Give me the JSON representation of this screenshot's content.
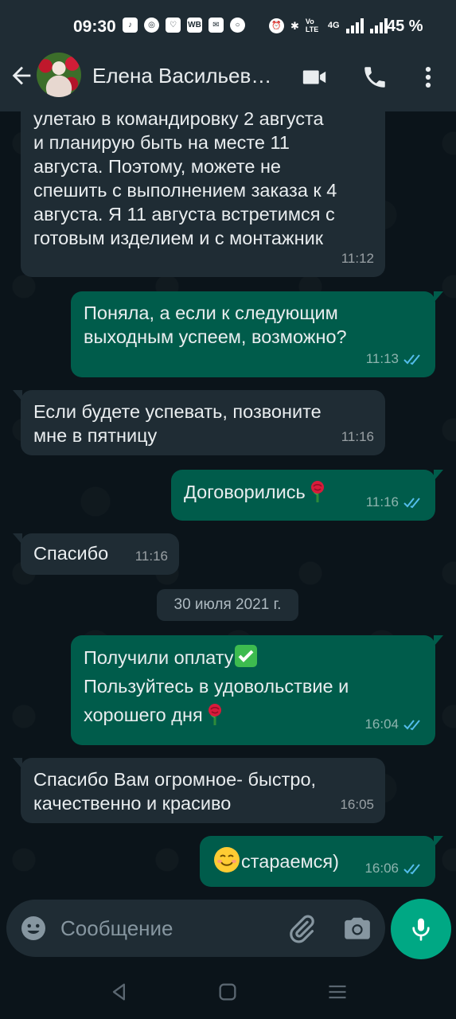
{
  "status_bar": {
    "time": "09:30",
    "battery": "45 %",
    "network_4g": "4G",
    "volte": "Vo LTE"
  },
  "header": {
    "contact_name": "Елена Васильев…"
  },
  "messages": [
    {
      "direction": "incoming",
      "text": "улетаю в командировку 2 августа\nи планирую быть на месте 11\nавгуста. Поэтому, можете не\nспешить с выполнением заказа к 4\nавгуста. Я 11 августа встретимся с\nготовым изделием и с монтажник",
      "time": "11:12"
    },
    {
      "direction": "outgoing",
      "text": "Поняла, а если к следующим\nвыходным успеем, возможно?",
      "time": "11:13",
      "read": true
    },
    {
      "direction": "incoming",
      "text": "Если будете успевать, позвоните\nмне в пятницу",
      "time": "11:16"
    },
    {
      "direction": "outgoing",
      "text": "Договорились",
      "emoji": "rose",
      "time": "11:16",
      "read": true
    },
    {
      "direction": "incoming",
      "text": "Спасибо",
      "time": "11:16"
    },
    {
      "direction": "outgoing",
      "text_line1": "Получили оплату",
      "emoji_line1": "check-mark",
      "text_line2": "Пользуйтесь в удовольствие и",
      "text_line3": "хорошего дня",
      "emoji_line3": "rose",
      "time": "16:04",
      "read": true
    },
    {
      "direction": "incoming",
      "text": "Спасибо Вам огромное- быстро,\nкачественно и красиво",
      "time": "16:05"
    },
    {
      "direction": "outgoing",
      "emoji": "smiling-face",
      "text": "стараемся)",
      "time": "16:06",
      "read": true
    }
  ],
  "date_divider": "30 июля 2021 г.",
  "composer": {
    "placeholder": "Сообщение"
  },
  "icons": {
    "back": "arrow-left-icon",
    "video": "video-call-icon",
    "call": "phone-icon",
    "menu": "more-vertical-icon",
    "emoji": "emoji-icon",
    "attach": "paperclip-icon",
    "camera": "camera-icon",
    "mic": "microphone-icon",
    "read_receipt": "double-check-icon"
  },
  "colors": {
    "background": "#0b141a",
    "bar": "#1f2c34",
    "incoming_bubble": "#1f2c34",
    "outgoing_bubble": "#005c4b",
    "accent": "#00a884",
    "read_tick": "#53bdeb"
  }
}
